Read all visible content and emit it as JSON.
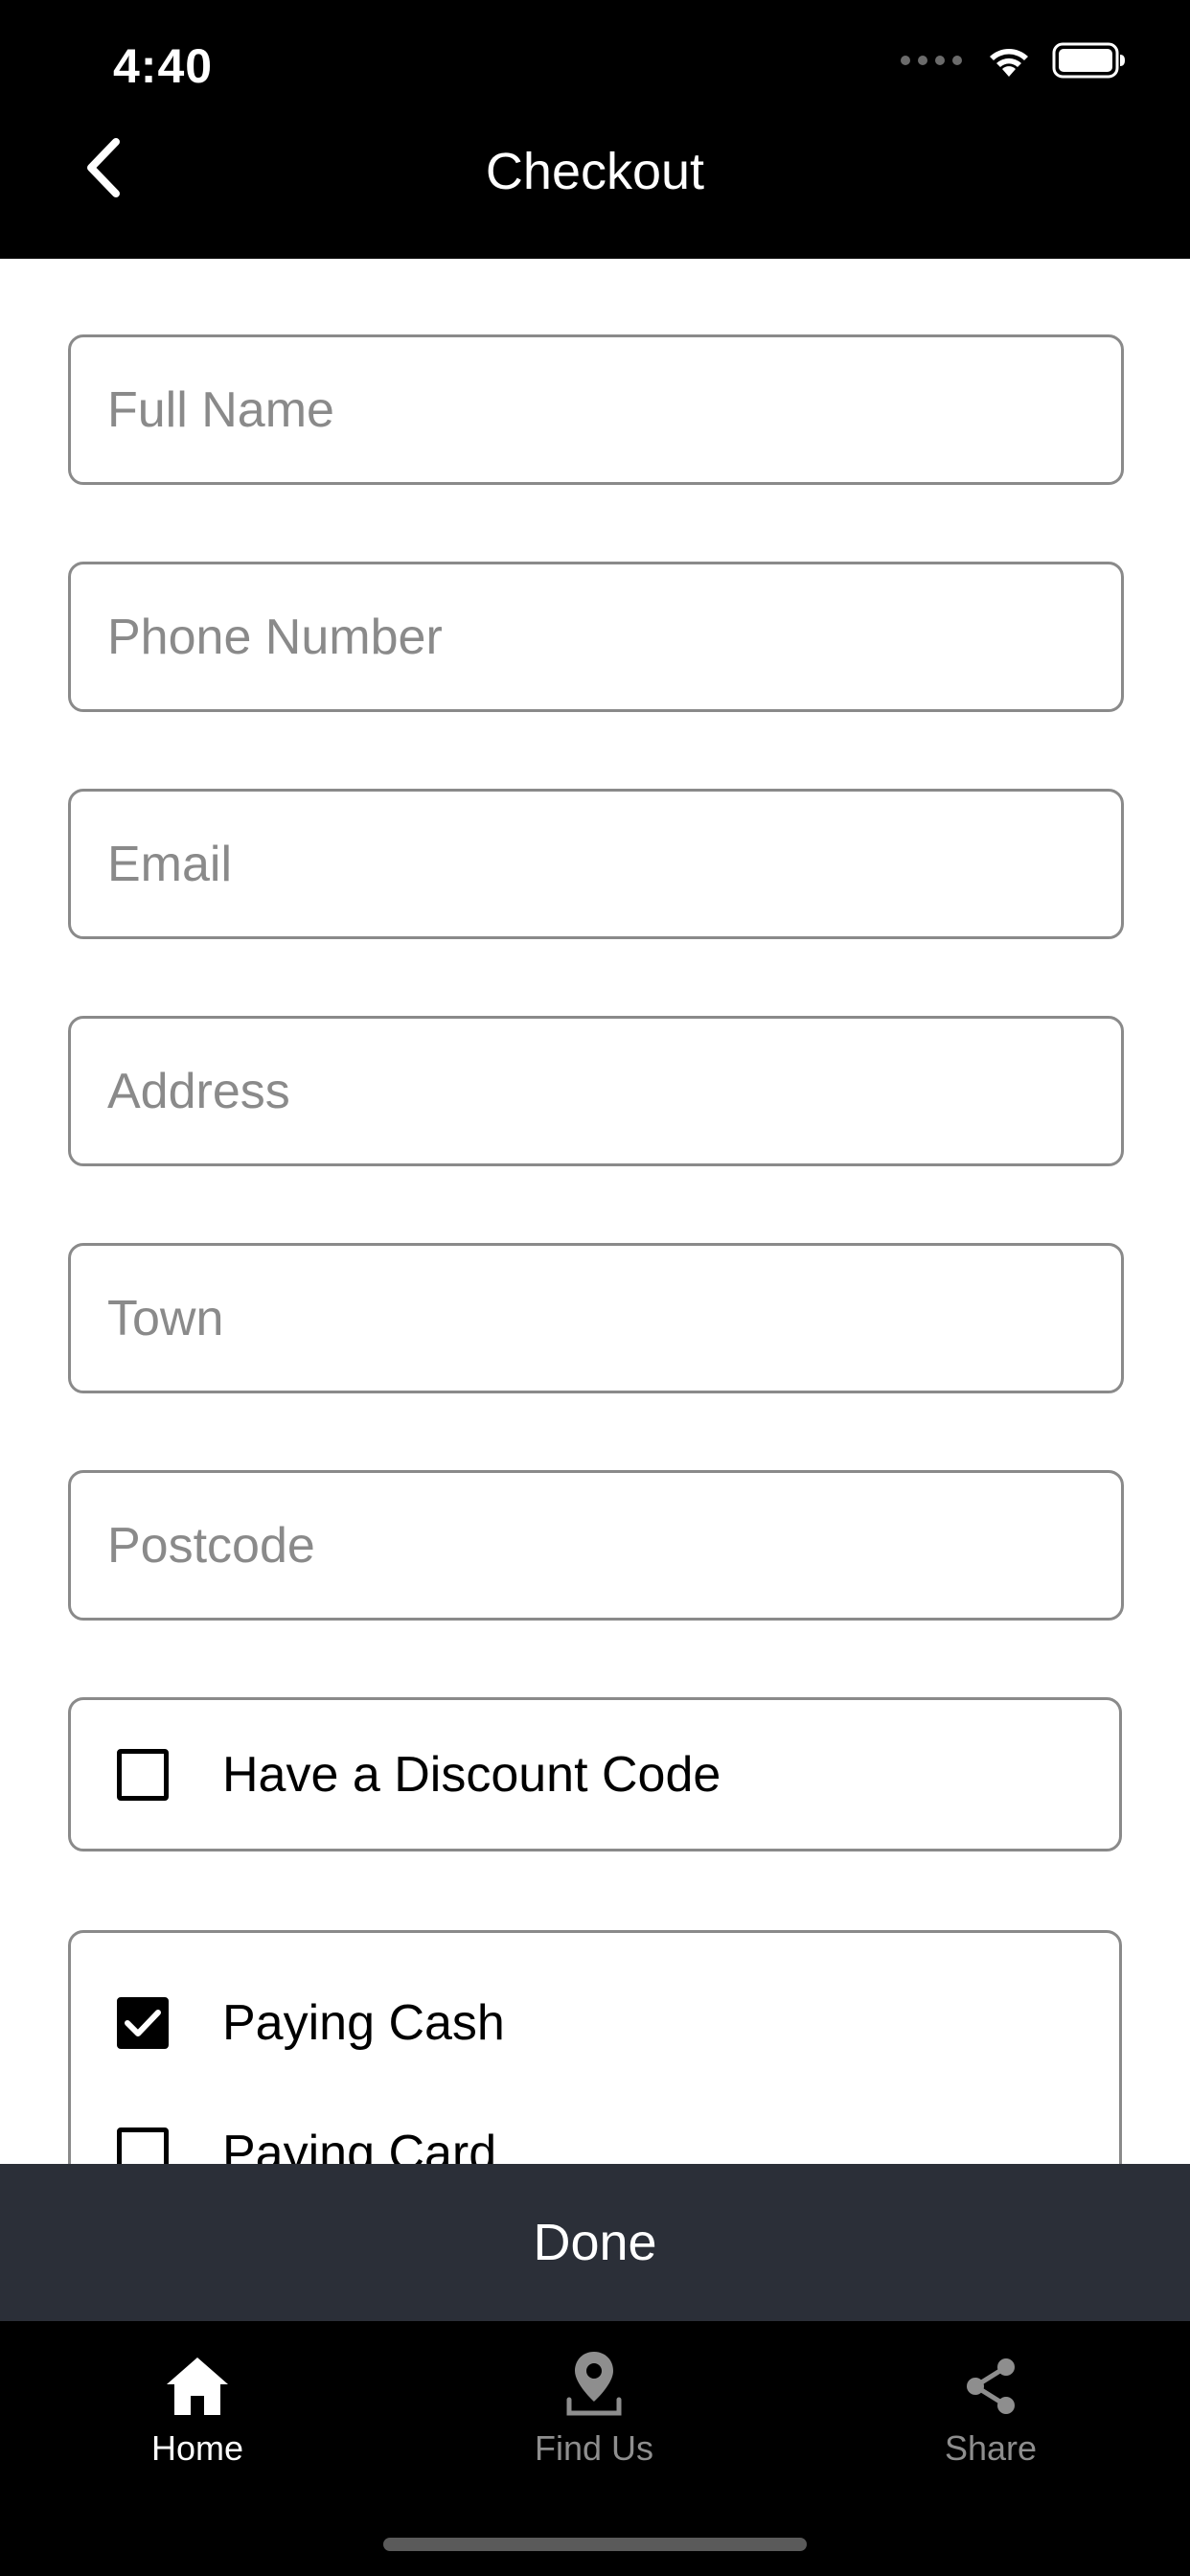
{
  "status_bar": {
    "time": "4:40",
    "icons": [
      "signal-dots-icon",
      "wifi-icon",
      "battery-icon"
    ]
  },
  "nav": {
    "title": "Checkout",
    "back_icon": "chevron-left-icon"
  },
  "form": {
    "full_name": {
      "placeholder": "Full Name",
      "value": ""
    },
    "phone": {
      "placeholder": "Phone Number",
      "value": ""
    },
    "email": {
      "placeholder": "Email",
      "value": ""
    },
    "address": {
      "placeholder": "Address",
      "value": ""
    },
    "town": {
      "placeholder": "Town",
      "value": ""
    },
    "postcode": {
      "placeholder": "Postcode",
      "value": ""
    },
    "discount": {
      "label": "Have a Discount Code",
      "checked": false
    },
    "payment": {
      "cash": {
        "label": "Paying Cash",
        "checked": true
      },
      "card": {
        "label": "Paying Card",
        "checked": false
      }
    }
  },
  "done_button": {
    "label": "Done"
  },
  "tab_bar": {
    "items": [
      {
        "label": "Home",
        "icon": "home-icon",
        "active": true
      },
      {
        "label": "Find Us",
        "icon": "map-pin-icon",
        "active": false
      },
      {
        "label": "Share",
        "icon": "share-icon",
        "active": false
      }
    ]
  },
  "colors": {
    "header_bg": "#000000",
    "done_bar_bg": "#2b2f38",
    "field_border": "#8a8a8a",
    "placeholder": "#8a8a8a",
    "tab_inactive": "#8e8e8e",
    "tab_active": "#ffffff"
  }
}
